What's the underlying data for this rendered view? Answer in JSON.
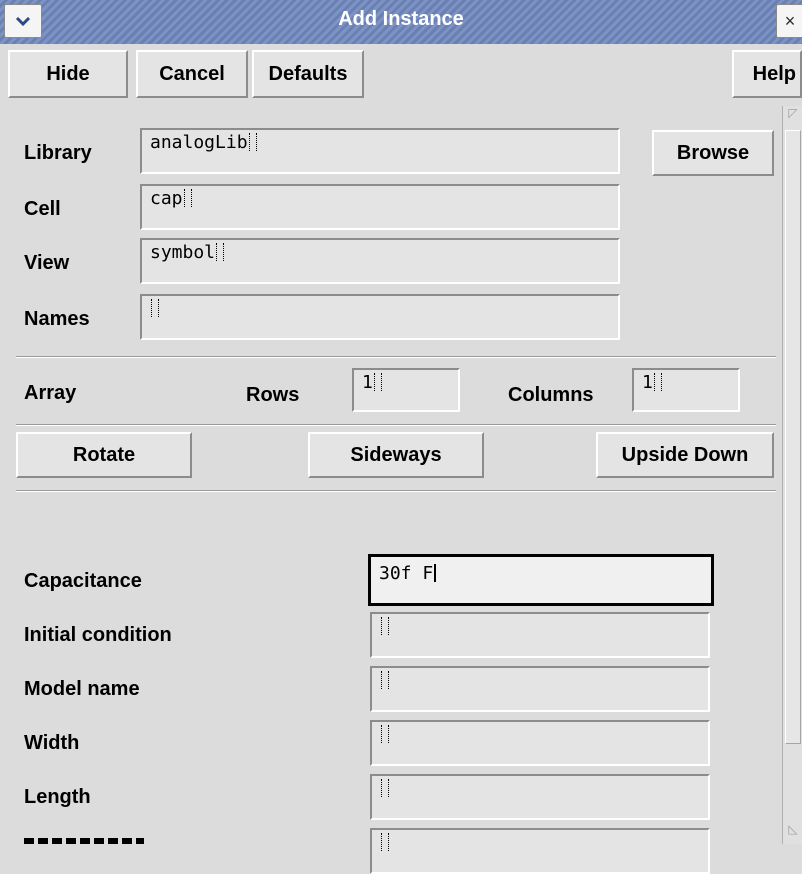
{
  "window": {
    "title": "Add Instance",
    "menu_icon": "chevron-down-icon",
    "close_icon": "close-icon",
    "close_glyph": "×"
  },
  "toolbar": {
    "hide_label": "Hide",
    "cancel_label": "Cancel",
    "defaults_label": "Defaults",
    "help_label": "Help"
  },
  "instance": {
    "library_label": "Library",
    "library_value": "analogLib",
    "browse_label": "Browse",
    "cell_label": "Cell",
    "cell_value": "cap",
    "view_label": "View",
    "view_value": "symbol",
    "names_label": "Names",
    "names_value": ""
  },
  "array": {
    "label": "Array",
    "rows_label": "Rows",
    "rows_value": "1",
    "columns_label": "Columns",
    "columns_value": "1"
  },
  "orientation": {
    "rotate_label": "Rotate",
    "sideways_label": "Sideways",
    "upside_down_label": "Upside Down"
  },
  "properties": [
    {
      "label": "Capacitance",
      "value": "30f F"
    },
    {
      "label": "Initial condition",
      "value": ""
    },
    {
      "label": "Model name",
      "value": ""
    },
    {
      "label": "Width",
      "value": ""
    },
    {
      "label": "Length",
      "value": ""
    }
  ]
}
